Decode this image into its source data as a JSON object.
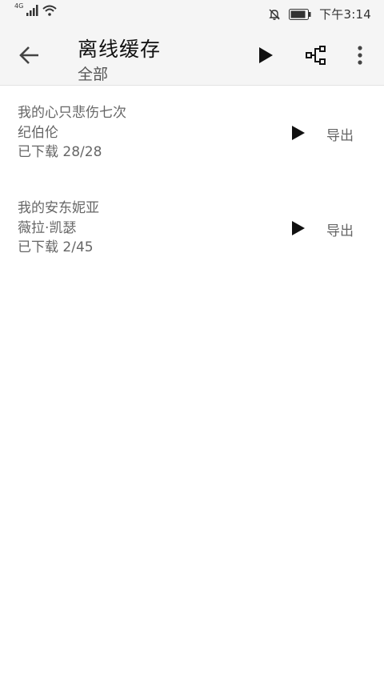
{
  "status_bar": {
    "network": "4G",
    "time": "下午3:14"
  },
  "app_bar": {
    "title": "离线缓存",
    "subtitle": "全部",
    "icons": [
      "back-arrow-icon",
      "play-icon",
      "tree-icon",
      "more-vert-icon"
    ]
  },
  "items": [
    {
      "song": "我的心只悲伤七次",
      "artist": "纪伯伦",
      "progress": "已下载 28/28",
      "export_label": "导出"
    },
    {
      "song": "我的安东妮亚",
      "artist": "薇拉·凯瑟",
      "progress": "已下载 2/45",
      "export_label": "导出"
    }
  ],
  "colors": {
    "icon": "#222222",
    "text_secondary": "#666666",
    "bar_bg": "#f5f5f5"
  }
}
